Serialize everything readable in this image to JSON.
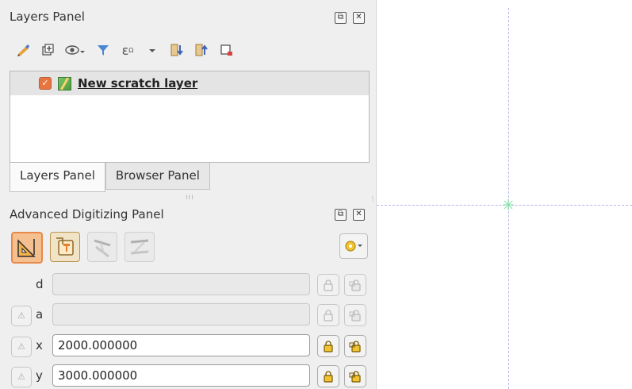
{
  "layers_panel": {
    "title": "Layers Panel",
    "toolbar_icons": [
      "style-brush-icon",
      "add-group-icon",
      "visibility-eye-icon",
      "filter-icon",
      "expression-filter-icon",
      "dropdown-arrow-icon",
      "expand-all-icon",
      "collapse-all-icon",
      "remove-layer-icon"
    ],
    "layers": [
      {
        "name": "New scratch layer",
        "checked": true,
        "type": "vector-line-layer"
      }
    ]
  },
  "tabs": [
    {
      "label": "Layers Panel",
      "active": true
    },
    {
      "label": "Browser Panel",
      "active": false
    }
  ],
  "advanced_digitizing": {
    "title": "Advanced Digitizing Panel",
    "tool_icons": [
      "cad-enable-icon",
      "construction-mode-icon",
      "parallel-icon",
      "perpendicular-icon"
    ],
    "settings_icon": "gear-icon",
    "fields": [
      {
        "label": "d",
        "value": "",
        "enabled": false,
        "has_relative": false
      },
      {
        "label": "a",
        "value": "",
        "enabled": false,
        "has_relative": true
      },
      {
        "label": "x",
        "value": "2000.000000",
        "enabled": true,
        "has_relative": true
      },
      {
        "label": "y",
        "value": "3000.000000",
        "enabled": true,
        "has_relative": true
      }
    ]
  },
  "canvas": {
    "crosshair_color": "#b3b3ee",
    "cursor_color": "#7ee0a0"
  }
}
